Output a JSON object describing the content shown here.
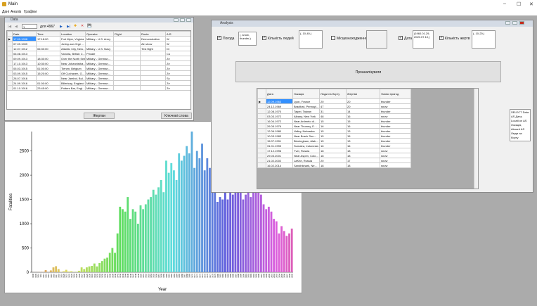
{
  "app": {
    "title": "Main",
    "menu": [
      "Дані",
      "Аналіз",
      "Графіки"
    ],
    "win_ctrls": [
      "–",
      "☐",
      "✕"
    ]
  },
  "data_form": {
    "title": "Data",
    "nav": {
      "pos": "1",
      "count": "для 4967",
      "ctrls": [
        "|◀",
        "◀",
        "▶",
        "▶|",
        "✚",
        "✕",
        "💾"
      ]
    },
    "columns": [
      "Date",
      "Time",
      "Location",
      "Operator",
      "Flight",
      "Route",
      "A.R"
    ],
    "rows": [
      [
        "17.09.1908",
        "17:18:00",
        "Fort Myer, Virginia",
        "Military - U.S. Army",
        "",
        "Demonstration",
        "W"
      ],
      [
        "07.09.1909",
        "",
        "Juvisy-sur-Orge…",
        "",
        "",
        "Air show",
        "W"
      ],
      [
        "12.07.1912",
        "06:30:00",
        "Atlantic City, New…",
        "Military - U.S. Navy",
        "",
        "Test flight",
        "Dr"
      ],
      [
        "06.08.1913",
        "",
        "Victoria, British C…",
        "Private",
        "",
        "",
        "Cu"
      ],
      [
        "09.09.1913",
        "18:30:00",
        "Over the North Sea",
        "Military - German…",
        "",
        "",
        "Ze"
      ],
      [
        "17.10.1913",
        "10:30:00",
        "Near Johannistha…",
        "Military - German…",
        "",
        "",
        "Ze"
      ],
      [
        "05.03.1915",
        "01:00:00",
        "Tienen, Belgium",
        "Military - German…",
        "",
        "",
        "Ze"
      ],
      [
        "03.09.1915",
        "15:20:00",
        "Off Cuxhaven, G…",
        "Military - German…",
        "",
        "",
        "Ze"
      ],
      [
        "28.07.1916",
        "",
        "Near Jambol, Bul…",
        "Military - German…",
        "",
        "",
        "Sc"
      ],
      [
        "24.09.1916",
        "01:00:00",
        "Billericay, England",
        "Military - German…",
        "",
        "",
        "Ze"
      ],
      [
        "01.10.1916",
        "23:45:00",
        "Potters Bar, Engl…",
        "Military - German…",
        "",
        "",
        "Ze"
      ]
    ],
    "btn_victims": "Жертви",
    "btn_keywords": "Ключові слова"
  },
  "analysis": {
    "title": "Analysis",
    "cb_weather": "Погода",
    "weather_val": "(, snow, thunder,)",
    "cb_people": "Кількість людей",
    "people_val": "(, 10-40,)",
    "cb_location": "Місцезнаходження",
    "cb_date": "Дата",
    "date_val": "(1960.01.29-2020.07.10,)",
    "cb_victims": "Кількість жертв",
    "victims_val": "(, 10-20,)",
    "btn_analyze": "Проаналізувати",
    "columns": [
      "Дата",
      "Локація",
      "Люди на борту",
      "Жертви",
      "Умови пригод"
    ],
    "rows": [
      [
        "12.09.1963",
        "Lyon, France",
        "20",
        "20",
        "thunder"
      ],
      [
        "24.12.1969",
        "Bradford, Pennsyl…",
        "47",
        "20",
        "snow"
      ],
      [
        "12.08.1970",
        "Taipei, Taiwan",
        "31",
        "14",
        "thunder"
      ],
      [
        "03.03.1972",
        "Albany, New York",
        "48",
        "16",
        "snow"
      ],
      [
        "16.04.1972",
        "Near Ardmelo di…",
        "15",
        "15",
        "thunder"
      ],
      [
        "26.05.1976",
        "Near Thorney, E…",
        "16",
        "16",
        "thunder"
      ],
      [
        "12.06.1980",
        "Valley, Nebraska",
        "15",
        "13",
        "thunder"
      ],
      [
        "10.03.1983",
        "Near Brach Sou…",
        "15",
        "15",
        "thunder"
      ],
      [
        "15.07.1991",
        "Birmingham, Alab…",
        "15",
        "13",
        "thunder"
      ],
      [
        "31.01.1993",
        "Sumatra, Indonesia",
        "16",
        "16",
        "thunder"
      ],
      [
        "17.12.1996",
        "Tver, Russia",
        "18",
        "18",
        "snow"
      ],
      [
        "29.03.2001",
        "Near Aspen, Colo…",
        "18",
        "18",
        "snow"
      ],
      [
        "21.02.2002",
        "LaKhe, Russia",
        "20",
        "17",
        "snow"
      ],
      [
        "16.02.2014",
        "Sandhikhark, Ne…",
        "18",
        "18",
        "snow"
      ]
    ],
    "sql": "SELECT Data AS Дата, Locati on AS Локація, Aboard AS Люди на борту"
  },
  "chart_data": {
    "type": "bar",
    "xlabel": "Year",
    "ylabel": "Fatalities",
    "ylim": [
      0,
      2900
    ],
    "yticks": [
      0,
      500,
      1000,
      1500,
      2000,
      2500
    ],
    "x": [
      1908,
      1909,
      1910,
      1911,
      1912,
      1913,
      1914,
      1915,
      1916,
      1917,
      1918,
      1919,
      1920,
      1921,
      1922,
      1923,
      1924,
      1925,
      1926,
      1927,
      1928,
      1929,
      1930,
      1931,
      1932,
      1933,
      1934,
      1935,
      1936,
      1937,
      1938,
      1939,
      1940,
      1941,
      1942,
      1943,
      1944,
      1945,
      1946,
      1947,
      1948,
      1949,
      1950,
      1951,
      1952,
      1953,
      1954,
      1955,
      1956,
      1957,
      1958,
      1959,
      1960,
      1961,
      1962,
      1963,
      1964,
      1965,
      1966,
      1967,
      1968,
      1969,
      1970,
      1971,
      1972,
      1973,
      1974,
      1975,
      1976,
      1977,
      1978,
      1979,
      1980,
      1981,
      1982,
      1983,
      1984,
      1985,
      1986,
      1987,
      1988,
      1989,
      1990,
      1991,
      1992,
      1993,
      1994,
      1995,
      1996,
      1997,
      1998,
      1999,
      2000,
      2001,
      2002,
      2003,
      2004,
      2005,
      2006,
      2007,
      2008,
      2009
    ],
    "values": [
      1,
      1,
      2,
      5,
      5,
      44,
      2,
      38,
      100,
      124,
      65,
      5,
      20,
      50,
      15,
      20,
      5,
      10,
      30,
      100,
      65,
      100,
      120,
      130,
      180,
      120,
      190,
      230,
      280,
      300,
      400,
      500,
      400,
      800,
      1350,
      1300,
      1250,
      1550,
      1100,
      1300,
      1250,
      1000,
      1380,
      1300,
      1400,
      1500,
      1550,
      1700,
      1600,
      1750,
      1900,
      1650,
      2300,
      2050,
      2250,
      2100,
      1900,
      2450,
      2300,
      2400,
      2600,
      2450,
      2900,
      2150,
      2500,
      2350,
      2650,
      2100,
      2350,
      2150,
      2200,
      1950,
      1450,
      1550,
      1500,
      1950,
      1500,
      2150,
      1600,
      1900,
      2200,
      2100,
      1500,
      1600,
      1750,
      1550,
      1700,
      1850,
      1900,
      1600,
      1400,
      1300,
      1350,
      1250,
      1100,
      1050,
      800,
      950,
      850,
      750,
      800,
      900
    ]
  }
}
